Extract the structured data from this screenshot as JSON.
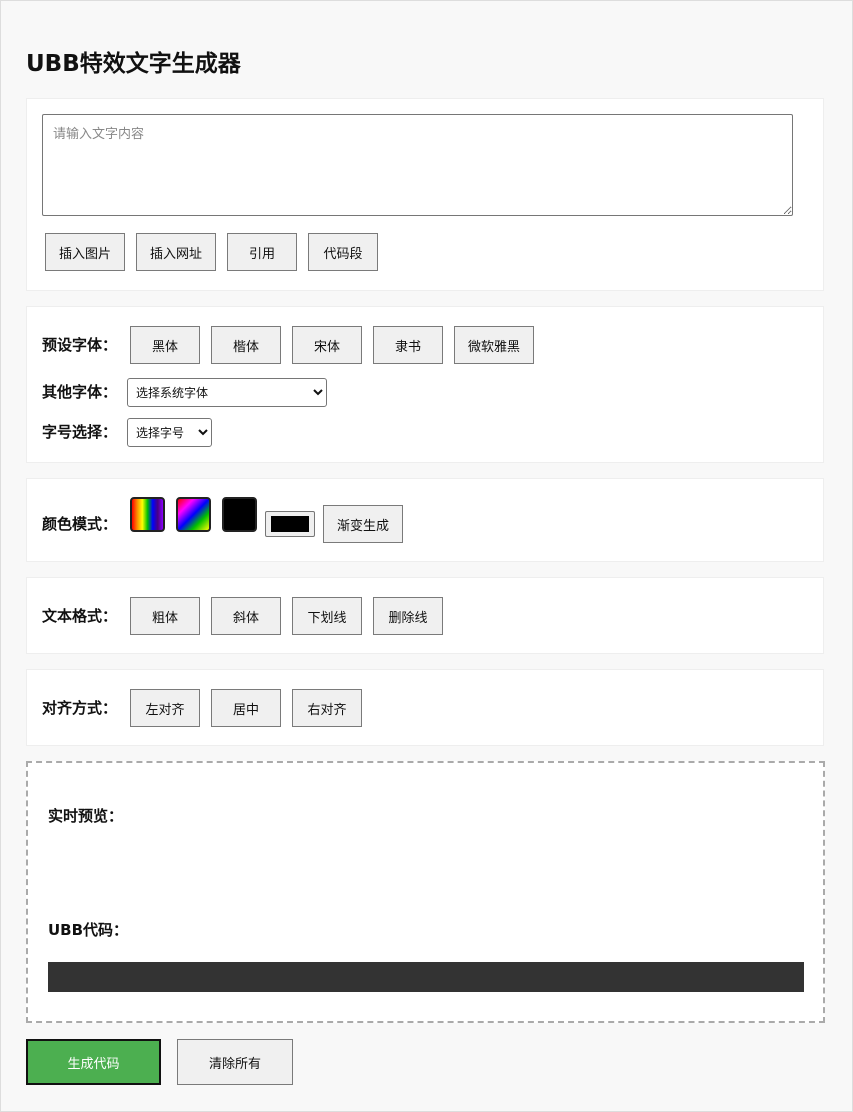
{
  "title": "UBB特效文字生成器",
  "editor": {
    "placeholder": "请输入文字内容",
    "value": "",
    "buttons": [
      "插入图片",
      "插入网址",
      "引用",
      "代码段"
    ]
  },
  "fonts": {
    "preset_label": "预设字体：",
    "preset_buttons": [
      "黑体",
      "楷体",
      "宋体",
      "隶书",
      "微软雅黑"
    ],
    "other_label": "其他字体：",
    "other_select": "选择系统字体",
    "size_label": "字号选择：",
    "size_select": "选择字号"
  },
  "color": {
    "label": "颜色模式：",
    "picker_value": "#000000",
    "gradient_button": "渐变生成"
  },
  "format": {
    "label": "文本格式：",
    "buttons": [
      "粗体",
      "斜体",
      "下划线",
      "删除线"
    ]
  },
  "align": {
    "label": "对齐方式：",
    "buttons": [
      "左对齐",
      "居中",
      "右对齐"
    ]
  },
  "preview": {
    "label": "实时预览：",
    "code_label": "UBB代码：",
    "code": ""
  },
  "actions": {
    "generate": "生成代码",
    "clear": "清除所有"
  },
  "colors": {
    "primary": "#4caf50",
    "code_bg": "#333333",
    "page_bg": "#f8f8f8"
  }
}
